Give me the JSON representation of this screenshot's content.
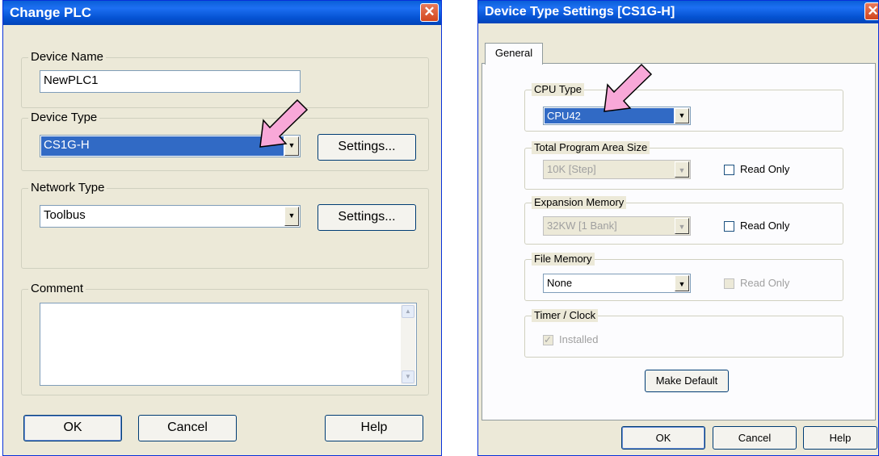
{
  "change_plc": {
    "title": "Change PLC",
    "close_glyph": "✕",
    "device_name": {
      "label": "Device Name",
      "value": "NewPLC1"
    },
    "device_type": {
      "label": "Device Type",
      "value": "CS1G-H",
      "settings_label": "Settings..."
    },
    "network_type": {
      "label": "Network Type",
      "value": "Toolbus",
      "settings_label": "Settings..."
    },
    "comment": {
      "label": "Comment",
      "value": ""
    },
    "buttons": {
      "ok": "OK",
      "cancel": "Cancel",
      "help": "Help"
    }
  },
  "device_settings": {
    "title": "Device Type Settings [CS1G-H]",
    "close_glyph": "✕",
    "tab": "General",
    "cpu_type": {
      "label": "CPU Type",
      "value": "CPU42"
    },
    "program_area": {
      "label": "Total Program Area Size",
      "value": "10K [Step]",
      "read_only": "Read Only",
      "checked": false
    },
    "expansion_memory": {
      "label": "Expansion Memory",
      "value": "32KW [1 Bank]",
      "read_only": "Read Only",
      "checked": false
    },
    "file_memory": {
      "label": "File Memory",
      "value": "None",
      "read_only": "Read Only",
      "checked": false
    },
    "timer_clock": {
      "label": "Timer / Clock",
      "installed": "Installed",
      "checked": true
    },
    "make_default": "Make Default",
    "buttons": {
      "ok": "OK",
      "cancel": "Cancel",
      "help": "Help"
    }
  },
  "icons": {
    "dropdown_arrow": "▼",
    "scroll_up": "▲",
    "scroll_down": "▼",
    "check": "✓"
  },
  "colors": {
    "titlebar": "#0553d3",
    "selection": "#316ac5",
    "pointer_arrow": "#f8a8d8",
    "dialog_face": "#ece9d8"
  }
}
